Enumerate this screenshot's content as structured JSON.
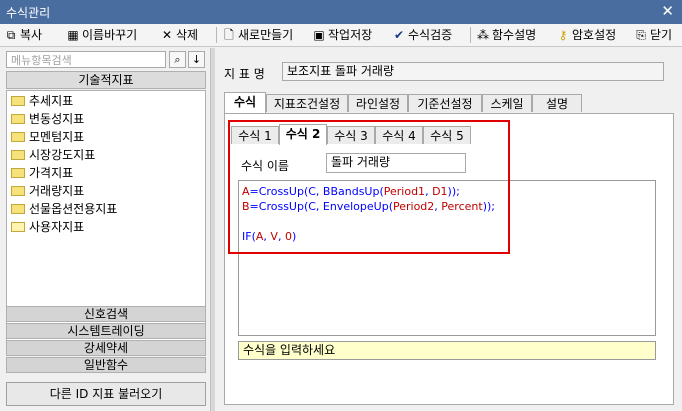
{
  "window": {
    "title": "수식관리",
    "close_symbol": "✕"
  },
  "toolbar": {
    "copy": "복사",
    "rename": "이름바꾸기",
    "delete": "삭제",
    "new": "새로만들기",
    "save": "작업저장",
    "verify": "수식검증",
    "func_help": "함수설명",
    "password": "암호설정",
    "close": "닫기"
  },
  "sidebar": {
    "search_placeholder": "메뉴항목검색",
    "category": "기술적지표",
    "items": [
      "추세지표",
      "변동성지표",
      "모멘텀지표",
      "시장강도지표",
      "가격지표",
      "거래량지표",
      "선물옵션전용지표",
      "사용자지표"
    ],
    "bottom_categories": [
      "신호검색",
      "시스템트레이딩",
      "강세약세",
      "일반함수"
    ],
    "load_button": "다른 ID 지표 불러오기"
  },
  "main": {
    "indicator_label": "지 표 명",
    "indicator_name": "보조지표 돌파 거래량",
    "tabs": [
      "수식",
      "지표조건설정",
      "라인설정",
      "기준선설정",
      "스케일",
      "설명"
    ],
    "active_tab": "수식",
    "formula_tabs": [
      "수식 1",
      "수식 2",
      "수식 3",
      "수식 4",
      "수식 5"
    ],
    "active_formula_tab": "수식 2",
    "formula_name_label": "수식 이름",
    "formula_name": "돌파 거래량",
    "code": {
      "line1": {
        "v": "A",
        "op": "=",
        "fn": "CrossUp",
        "a": "(C, BBandsUp(",
        "p1": "Period1",
        "sep": ", ",
        "p2": "D1",
        "end": "));"
      },
      "line2": {
        "v": "B",
        "op": "=",
        "fn": "CrossUp",
        "a": "(C, EnvelopeUp(",
        "p1": "Period2",
        "sep": ", ",
        "p2": "Percent",
        "end": "));"
      },
      "line4": {
        "fn": "IF",
        "open": "(",
        "a": "A",
        "s1": ", ",
        "b": "V",
        "s2": ", ",
        "c": "0",
        "close": ")"
      }
    },
    "hint": "수식을 입력하세요"
  },
  "colors": {
    "titlebar": "#4a6da0",
    "highlight_box": "#e00000",
    "keyword": "#0000ff",
    "variable": "#c00000",
    "hint_bg": "#ffffcc"
  }
}
